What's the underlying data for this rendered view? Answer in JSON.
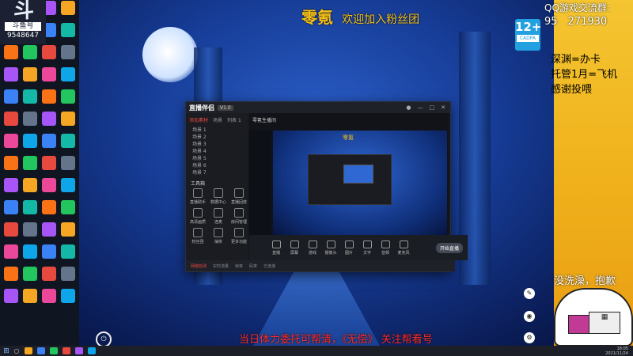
{
  "overlay": {
    "logo_sub": "斗鱼号",
    "logo_id": "9548647",
    "fan_title": "零氪",
    "fan_sub": "欢迎加入粉丝团",
    "qq_label": "QQ游戏交流群:",
    "qq_number": "95 271930",
    "right_lines": [
      "深渊=办卡",
      "托管1月=飞机",
      "感谢投喂"
    ],
    "sorry_text": "没洗澡，抱歉",
    "subtitle": "当日体力委托可帮清，《无偿》  关注帮看号",
    "age_rating": "12+",
    "age_sub": "CADPA"
  },
  "app": {
    "brand": "直播伴侣",
    "version": "V1.0",
    "room_title": "零氪生播间",
    "side_tabs": [
      "添加素材",
      "场景",
      "列表 1"
    ],
    "scenes": [
      "场景 1",
      "场景 2",
      "场景 3",
      "场景 4",
      "场景 5",
      "场景 6",
      "场景 7"
    ],
    "tools_title": "工具箱",
    "tools": [
      "直播助手",
      "数据中心",
      "直播回放",
      "高清画质",
      "连麦",
      "房间管理",
      "粉丝团",
      "抽奖",
      "更多功能"
    ],
    "toolbar": [
      "直播",
      "屏幕",
      "游戏",
      "摄像头",
      "图片",
      "文字",
      "音频",
      "麦克风"
    ],
    "live_button": "开始直播",
    "status": [
      "实时流量",
      "帧率",
      "码率",
      "已连接"
    ],
    "warn": "网络检测"
  },
  "taskbar": {
    "start_icon": "windows-logo",
    "time": "18:05",
    "date": "2021/11/24"
  },
  "colors": {
    "accent_red": "#e8493f",
    "banner_yellow": "#f5c017"
  }
}
